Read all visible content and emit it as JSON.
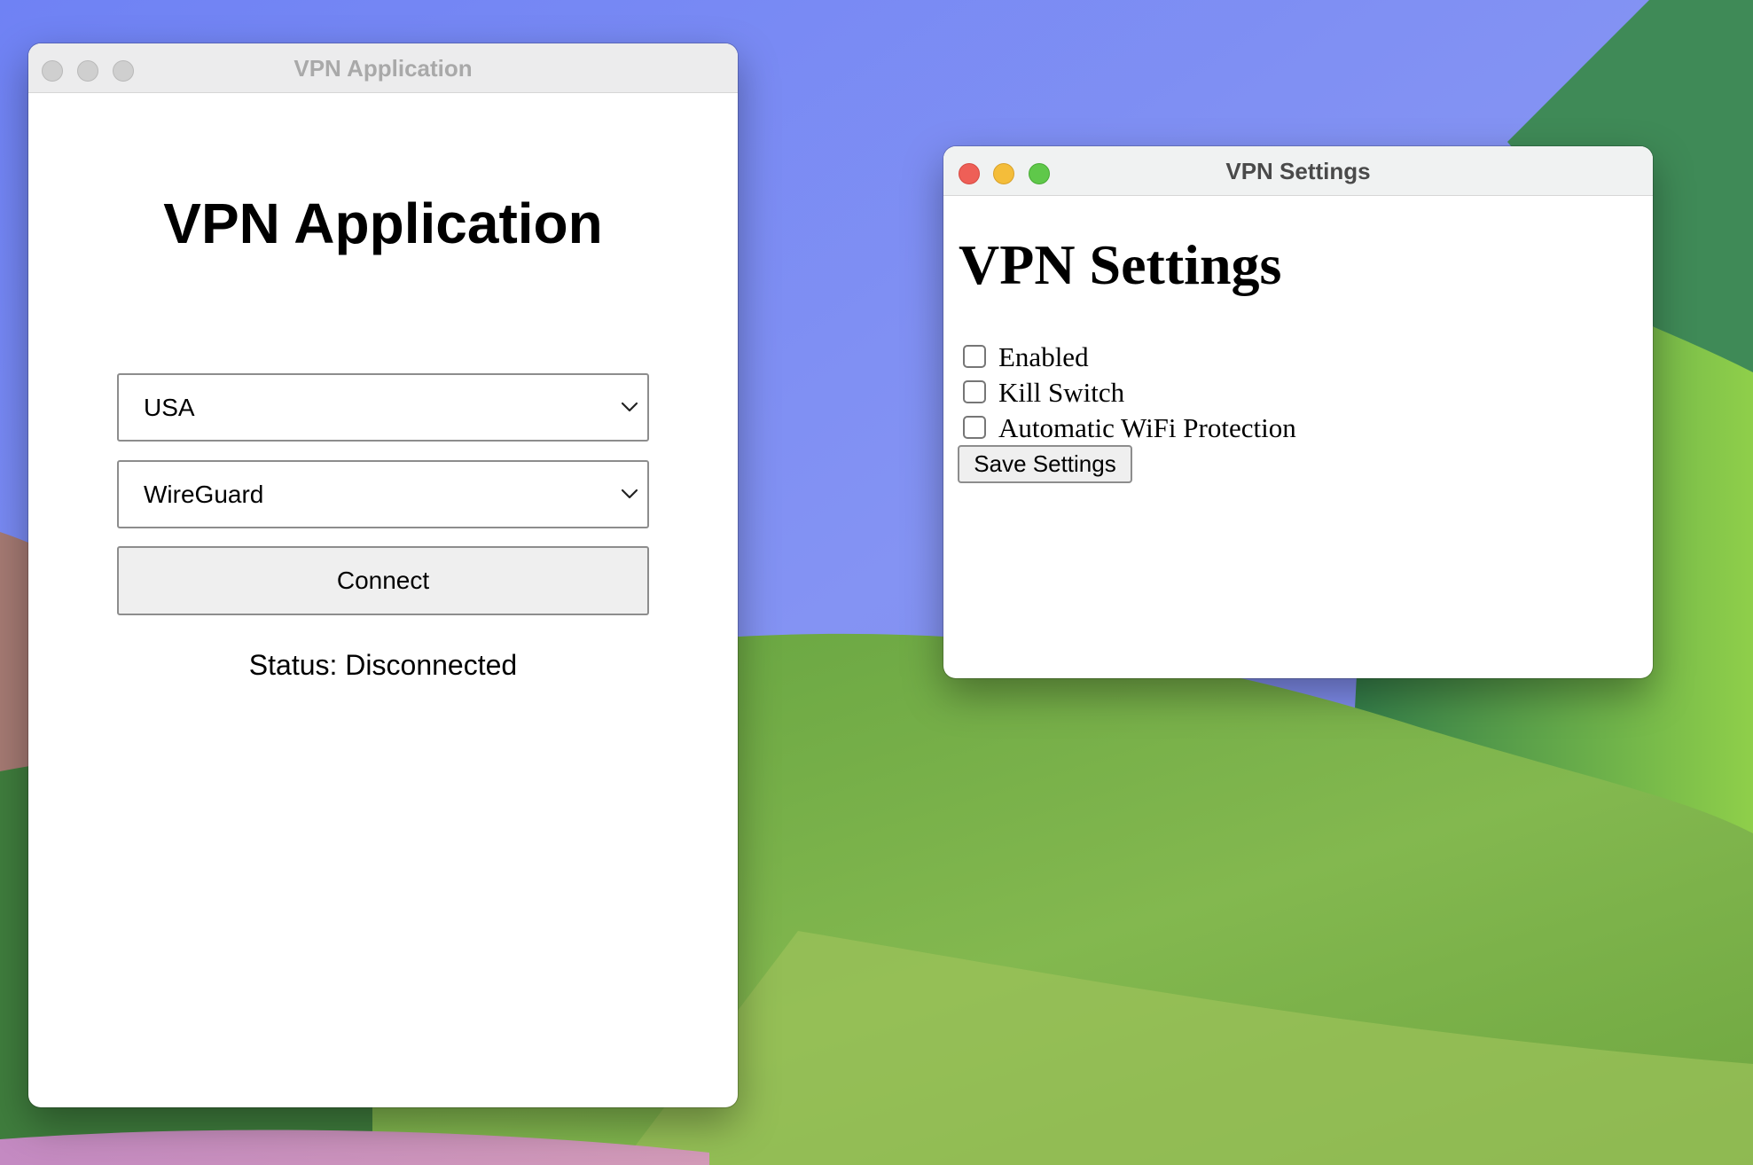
{
  "app_window": {
    "title": "VPN Application",
    "heading": "VPN Application",
    "country_select": {
      "value": "USA"
    },
    "protocol_select": {
      "value": "WireGuard"
    },
    "connect_label": "Connect",
    "status_text": "Status: Disconnected"
  },
  "settings_window": {
    "title": "VPN Settings",
    "heading": "VPN Settings",
    "options": [
      {
        "label": "Enabled",
        "checked": false
      },
      {
        "label": "Kill Switch",
        "checked": false
      },
      {
        "label": "Automatic WiFi Protection",
        "checked": false
      }
    ],
    "save_label": "Save Settings"
  },
  "icons": {
    "select_arrow": "chevron-down-icon"
  },
  "colors": {
    "close": "#ee5f57",
    "minimize": "#f4bd3a",
    "maximize": "#5fc84a",
    "button_bg": "#efefef"
  }
}
